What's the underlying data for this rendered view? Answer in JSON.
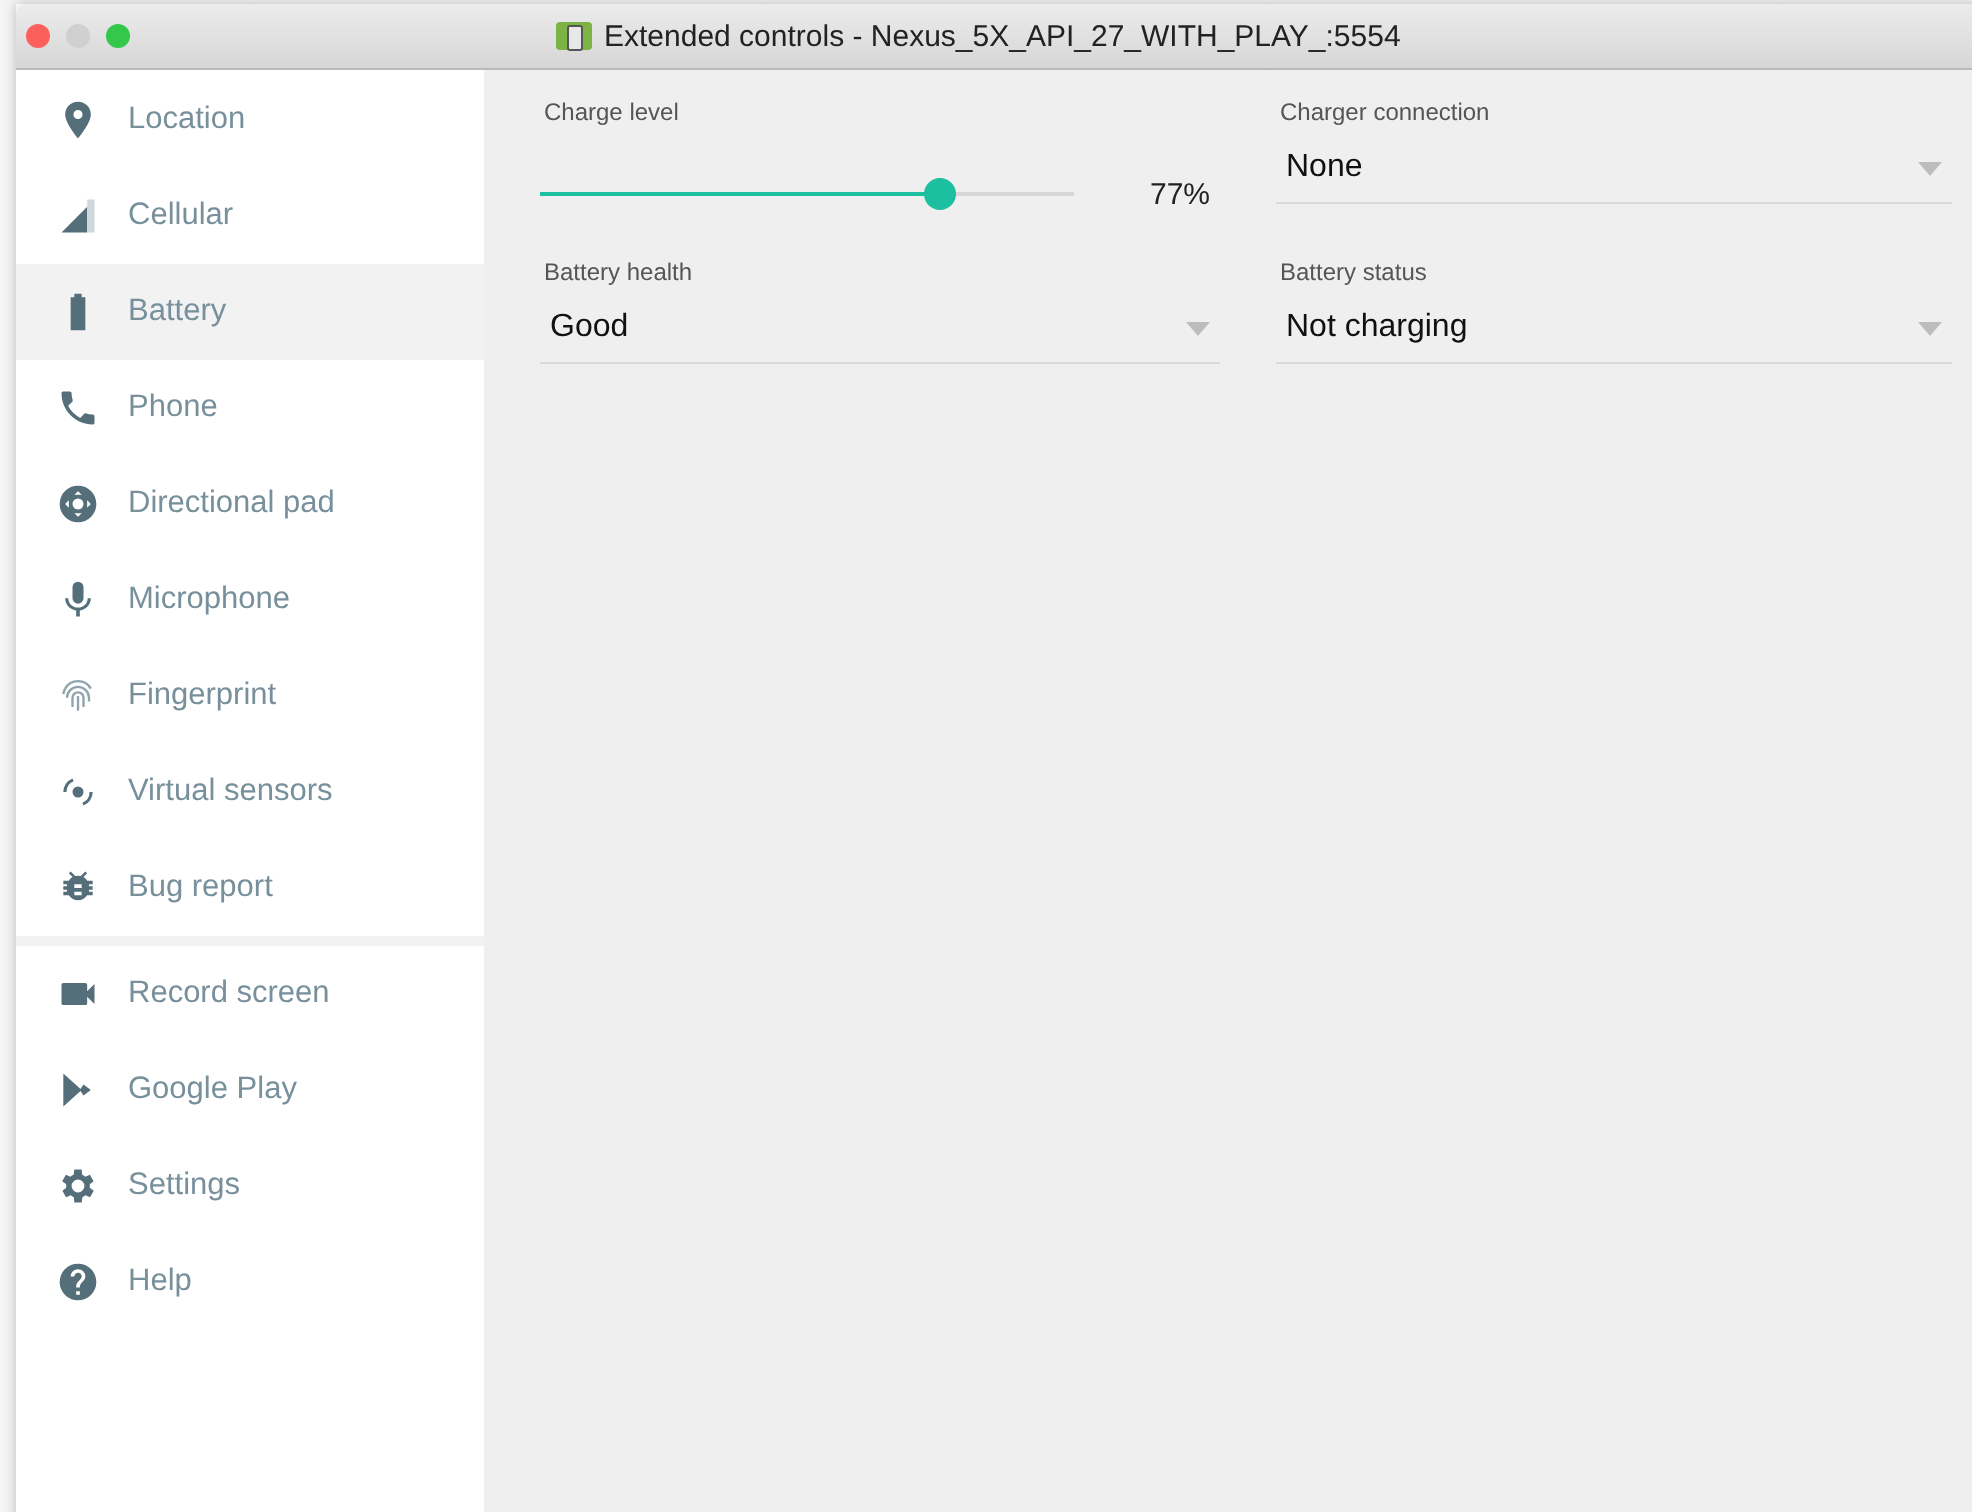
{
  "window": {
    "title": "Extended controls - Nexus_5X_API_27_WITH_PLAY_:5554"
  },
  "sidebar": {
    "groups": [
      {
        "items": [
          {
            "label": "Location",
            "selected": false
          },
          {
            "label": "Cellular",
            "selected": false
          },
          {
            "label": "Battery",
            "selected": true
          },
          {
            "label": "Phone",
            "selected": false
          },
          {
            "label": "Directional pad",
            "selected": false
          },
          {
            "label": "Microphone",
            "selected": false
          },
          {
            "label": "Fingerprint",
            "selected": false
          },
          {
            "label": "Virtual sensors",
            "selected": false
          },
          {
            "label": "Bug report",
            "selected": false
          }
        ]
      },
      {
        "items": [
          {
            "label": "Record screen",
            "selected": false
          },
          {
            "label": "Google Play",
            "selected": false
          },
          {
            "label": "Settings",
            "selected": false
          },
          {
            "label": "Help",
            "selected": false
          }
        ]
      }
    ]
  },
  "battery": {
    "charge_level": {
      "label": "Charge level",
      "level": 0.75,
      "reading": "77%"
    },
    "charger_connection": {
      "label": "Charger connection",
      "value": "None"
    },
    "battery_health": {
      "label": "Battery health",
      "value": "Good"
    },
    "battery_status": {
      "label": "Battery status",
      "value": "Not charging"
    }
  }
}
